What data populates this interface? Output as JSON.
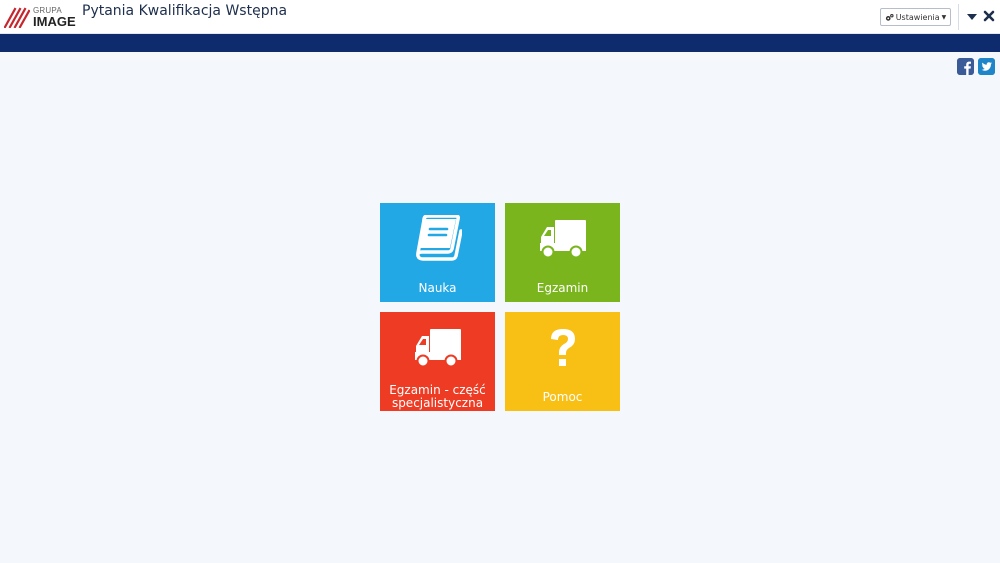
{
  "header": {
    "logo_small": "GRUPA",
    "logo_big": "IMAGE",
    "title": "Pytania Kwalifikacja Wstępna",
    "settings_label": "Ustawienia",
    "settings_icon": "gears-icon",
    "minimize_icon": "triangle-down-icon",
    "close_icon": "close-x-icon"
  },
  "social": {
    "facebook_icon": "facebook-icon",
    "twitter_icon": "twitter-icon"
  },
  "tiles": [
    {
      "label": "Nauka",
      "icon": "book-icon",
      "color": "#23a8e6"
    },
    {
      "label": "Egzamin",
      "icon": "truck-icon",
      "color": "#7ab51d"
    },
    {
      "label_line1": "Egzamin - część",
      "label_line2": "specjalistyczna",
      "icon": "truck-icon",
      "color": "#ee3b23"
    },
    {
      "label": "Pomoc",
      "icon": "question-icon",
      "color": "#f8bf14"
    }
  ],
  "colors": {
    "navbar": "#0e2b6e",
    "background": "#f4f8fc",
    "title_text": "#1d2f4d"
  }
}
